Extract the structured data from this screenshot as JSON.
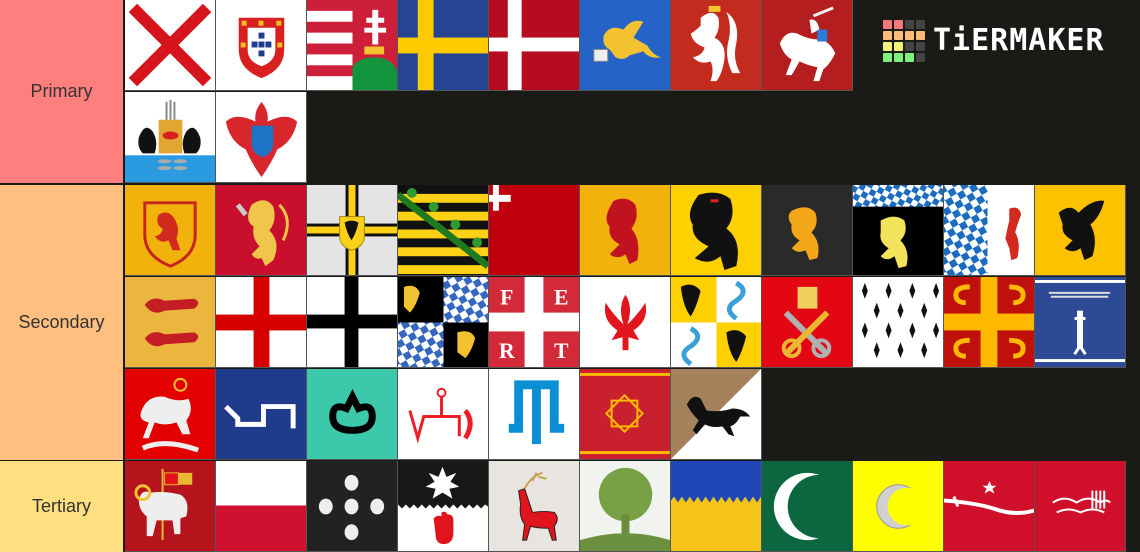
{
  "app": {
    "brand": "TiERMAKER",
    "logo_grid": [
      "#f47a7a",
      "#f47a7a",
      "#444",
      "#444",
      "#ffbb78",
      "#ffbb78",
      "#ffbb78",
      "#ffbb78",
      "#f2f27a",
      "#f2f27a",
      "#444",
      "#444",
      "#7ef07e",
      "#7ef07e",
      "#7ef07e",
      "#444"
    ]
  },
  "tiers": [
    {
      "label": "Primary",
      "color": "#ff7f7f",
      "items": [
        "burgundy-cross",
        "portugal-arms",
        "hungary-arms",
        "sweden-cross",
        "denmark-cross",
        "venice-lion",
        "bohemia-lion",
        "lithuania-vytis",
        "novgorod-arms",
        "brandenburg-eagle"
      ]
    },
    {
      "label": "Secondary",
      "color": "#ffbf7f",
      "items": [
        "scotland-arms",
        "norway-lion",
        "teutonic-cross",
        "saxony-arms",
        "swiss-corner",
        "holland-lion",
        "flanders-lion",
        "brabant-lion",
        "bavaria-palatinate",
        "bavaria-lozenge",
        "pomerania-griffin",
        "wales-lions",
        "england-cross",
        "prussia-cross",
        "palatinate-quarterly",
        "savoy-fert",
        "florence-lily",
        "milan-quarterly",
        "papal-keys",
        "brittany-ermine",
        "byzantine-tetragrammatic",
        "jaxa-sword",
        "georgia-stgeorge",
        "tamga-blue",
        "tamga-teal",
        "tamga-red",
        "crimean-tamga",
        "red-octagram",
        "black-horse"
      ]
    },
    {
      "label": "Tertiary",
      "color": "#ffdf7f",
      "items": [
        "gotland-lamb",
        "poland-bicolor",
        "scallop-shells",
        "ulster-star-hand",
        "red-stag",
        "green-tree",
        "wavy-blue-yellow",
        "green-crescent",
        "yellow-crescent",
        "red-sword-star",
        "red-shahada"
      ]
    }
  ],
  "fert_letters": [
    "F",
    "E",
    "R",
    "T"
  ]
}
